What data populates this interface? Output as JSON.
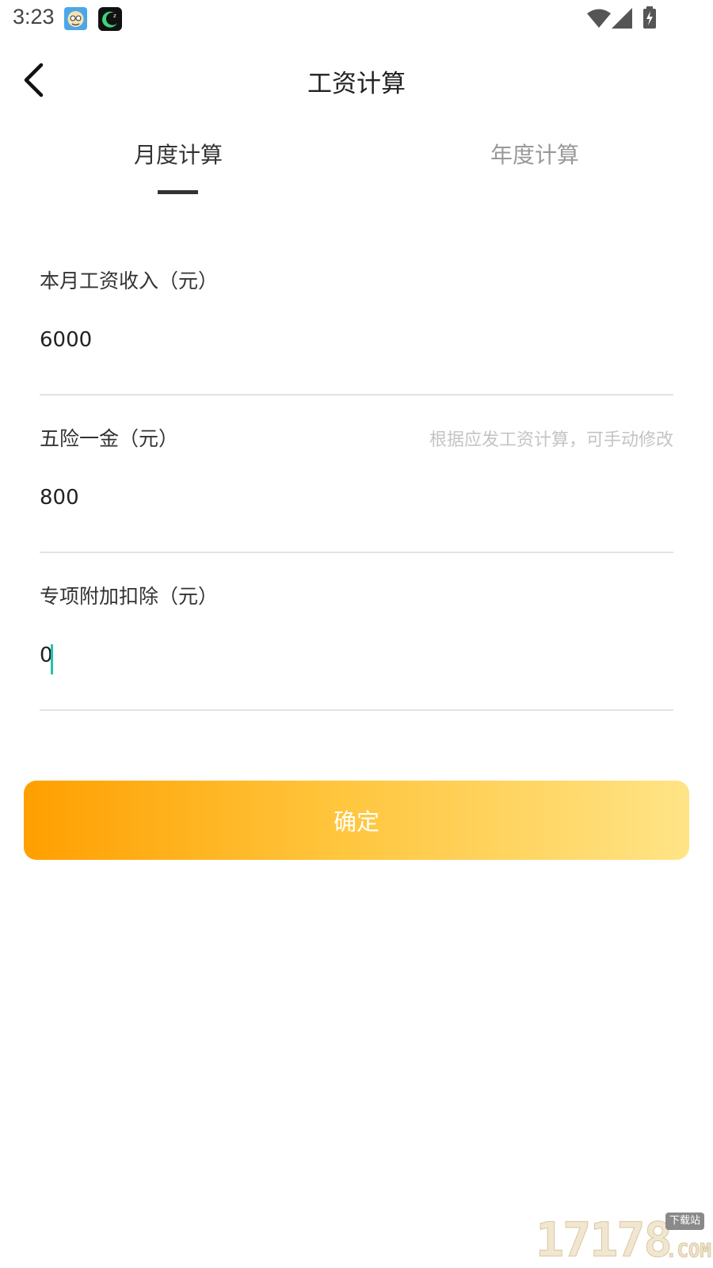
{
  "status_bar": {
    "time": "3:23",
    "icons": [
      "wifi-icon",
      "signal-icon",
      "battery-charging-icon"
    ]
  },
  "header": {
    "title": "工资计算",
    "back_icon": "chevron-left-icon"
  },
  "tabs": [
    {
      "label": "月度计算",
      "active": true
    },
    {
      "label": "年度计算",
      "active": false
    }
  ],
  "form": {
    "salary": {
      "label": "本月工资收入（元）",
      "value": "6000"
    },
    "insurance": {
      "label": "五险一金（元）",
      "hint": "根据应发工资计算，可手动修改",
      "value": "800"
    },
    "deduction": {
      "label": "专项附加扣除（元）",
      "value": "0"
    }
  },
  "confirm_label": "确定",
  "colors": {
    "accent_start": "#ff9f00",
    "accent_end": "#ffe486",
    "caret": "#20c3b0"
  },
  "watermark": {
    "number": "17178",
    "tag": "下载站",
    "suffix": ".COM"
  }
}
